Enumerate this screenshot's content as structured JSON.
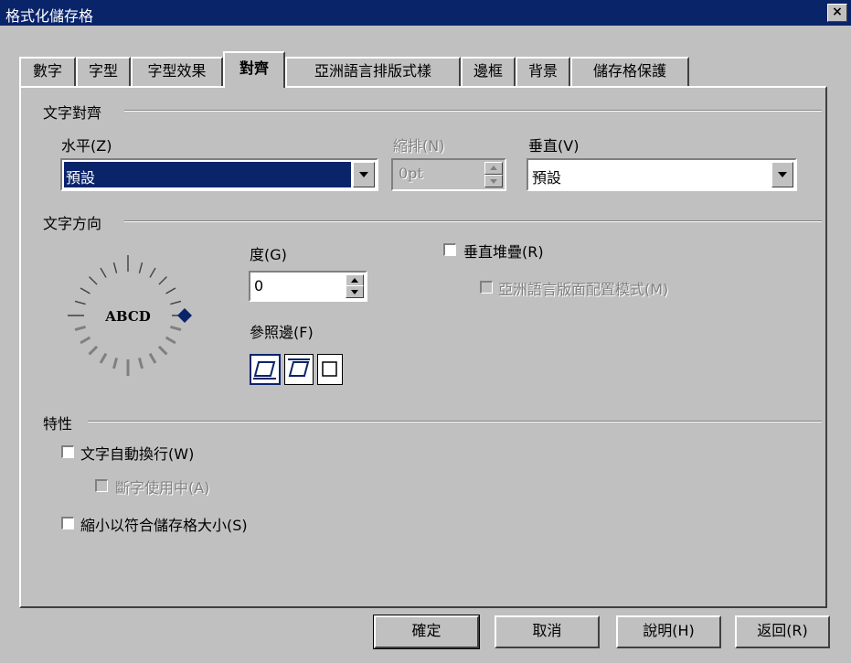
{
  "window": {
    "title": "格式化儲存格",
    "close": "×"
  },
  "tabs": [
    {
      "label": "數字",
      "active": false
    },
    {
      "label": "字型",
      "active": false
    },
    {
      "label": "字型效果",
      "active": false
    },
    {
      "label": "對齊",
      "active": true
    },
    {
      "label": "亞洲語言排版式樣",
      "active": false
    },
    {
      "label": "邊框",
      "active": false
    },
    {
      "label": "背景",
      "active": false
    },
    {
      "label": "儲存格保護",
      "active": false
    }
  ],
  "text_alignment": {
    "section": "文字對齊",
    "horizontal_label": "水平(Z)",
    "horizontal_value": "預設",
    "indent_label": "縮排(N)",
    "indent_value": "0pt",
    "vertical_label": "垂直(V)",
    "vertical_value": "預設"
  },
  "text_direction": {
    "section": "文字方向",
    "dial_text": "ABCD",
    "degree_label": "度(G)",
    "degree_value": "0",
    "reference_label": "參照邊(F)",
    "stacked_label": "垂直堆疊(R)",
    "asian_layout_label": "亞洲語言版面配置模式(M)"
  },
  "properties": {
    "section": "特性",
    "wrap_label": "文字自動換行(W)",
    "hyphen_label": "斷字使用中(A)",
    "shrink_label": "縮小以符合儲存格大小(S)"
  },
  "buttons": {
    "ok": "確定",
    "cancel": "取消",
    "help": "說明(H)",
    "reset": "返回(R)"
  },
  "colors": {
    "titlebar": "#0a246a",
    "selection": "#0a246a",
    "face": "#c0c0c0",
    "dial_dot": "#0a246a"
  }
}
